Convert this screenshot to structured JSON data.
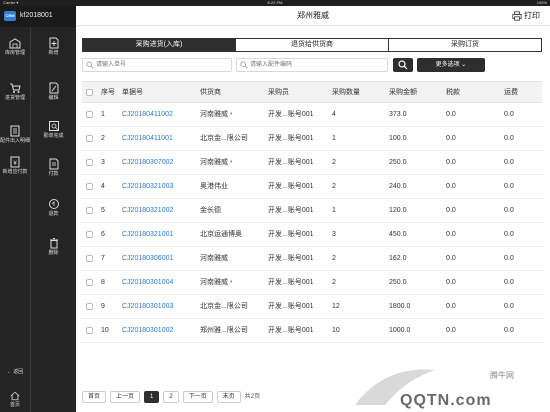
{
  "statusbar": {
    "carrier": "Carrier ▾",
    "time": "8:22 PM",
    "battery": "100%"
  },
  "sidebar": {
    "user": "kf2018001",
    "logo": "CRM",
    "left_items": [
      {
        "label": "库房管理",
        "icon": "warehouse-icon"
      },
      {
        "label": "进货管理",
        "icon": "cart-icon"
      },
      {
        "label": "配件出入明细",
        "icon": "list-icon"
      },
      {
        "label": "新增应付款",
        "icon": "payment-icon"
      }
    ],
    "right_items": [
      {
        "label": "新增",
        "icon": "add-icon"
      },
      {
        "label": "编辑",
        "icon": "edit-icon"
      },
      {
        "label": "勤单完成",
        "icon": "check-icon"
      },
      {
        "label": "付款",
        "icon": "pay-icon"
      },
      {
        "label": "退款",
        "icon": "refund-icon"
      },
      {
        "label": "删除",
        "icon": "trash-icon"
      }
    ],
    "back_label": "返回",
    "home_label": "首页"
  },
  "header": {
    "title": "郑州雅威",
    "print_label": "打印"
  },
  "tabs": [
    "采购进货(入库)",
    "退货给供货商",
    "采购订货"
  ],
  "search": {
    "order_placeholder": "请输入单号",
    "part_placeholder": "请输入配件编码",
    "more_label": "更多选项 ⌄"
  },
  "table": {
    "headers": [
      "序号",
      "单据号",
      "供货商",
      "采购员",
      "采购数量",
      "采购金额",
      "税款",
      "运费"
    ],
    "rows": [
      {
        "seq": "1",
        "no": "CJ20180411002",
        "supplier": "河南雅威",
        "dot": "•",
        "buyer": "开发...账号001",
        "qty": "4",
        "amount": "373.0",
        "tax": "0.0",
        "freight": "0.0"
      },
      {
        "seq": "2",
        "no": "CJ20180411001",
        "supplier": "北京金...限公司",
        "dot": "",
        "buyer": "开发...账号001",
        "qty": "1",
        "amount": "100.0",
        "tax": "0.0",
        "freight": "0.0"
      },
      {
        "seq": "3",
        "no": "CJ20180307002",
        "supplier": "河南雅威",
        "dot": "•",
        "buyer": "开发...账号001",
        "qty": "2",
        "amount": "250.0",
        "tax": "0.0",
        "freight": "0.0"
      },
      {
        "seq": "4",
        "no": "CJ20180321003",
        "supplier": "奥港伟业",
        "dot": "",
        "buyer": "开发...账号001",
        "qty": "2",
        "amount": "240.0",
        "tax": "0.0",
        "freight": "0.0"
      },
      {
        "seq": "5",
        "no": "CJ20180321002",
        "supplier": "金长德",
        "dot": "",
        "buyer": "开发...账号001",
        "qty": "1",
        "amount": "120.0",
        "tax": "0.0",
        "freight": "0.0"
      },
      {
        "seq": "6",
        "no": "CJ20180321001",
        "supplier": "北京运通博奥",
        "dot": "",
        "buyer": "开发...账号001",
        "qty": "3",
        "amount": "450.0",
        "tax": "0.0",
        "freight": "0.0"
      },
      {
        "seq": "7",
        "no": "CJ20180306001",
        "supplier": "河南雅威",
        "dot": "",
        "buyer": "开发...账号001",
        "qty": "2",
        "amount": "162.0",
        "tax": "0.0",
        "freight": "0.0"
      },
      {
        "seq": "8",
        "no": "CJ20180301004",
        "supplier": "河南雅威",
        "dot": "•",
        "buyer": "开发...账号001",
        "qty": "2",
        "amount": "250.0",
        "tax": "0.0",
        "freight": "0.0"
      },
      {
        "seq": "9",
        "no": "CJ20180301003",
        "supplier": "北京金...限公司",
        "dot": "",
        "buyer": "开发...账号001",
        "qty": "12",
        "amount": "1800.0",
        "tax": "0.0",
        "freight": "0.0"
      },
      {
        "seq": "10",
        "no": "CJ20180301002",
        "supplier": "郑州雅...限公司",
        "dot": "",
        "buyer": "开发...账号001",
        "qty": "10",
        "amount": "1000.0",
        "tax": "0.0",
        "freight": "0.0"
      }
    ]
  },
  "pager": {
    "first": "首页",
    "prev": "上一页",
    "pages": [
      "1",
      "2"
    ],
    "next": "下一页",
    "last": "末页",
    "total": "共2页"
  },
  "watermark": {
    "text": "QQTN.com",
    "cn": "腾牛网"
  },
  "colors": {
    "accent": "#2b7bd5",
    "dark": "#2e2e2e",
    "sidebar": "#242424"
  }
}
